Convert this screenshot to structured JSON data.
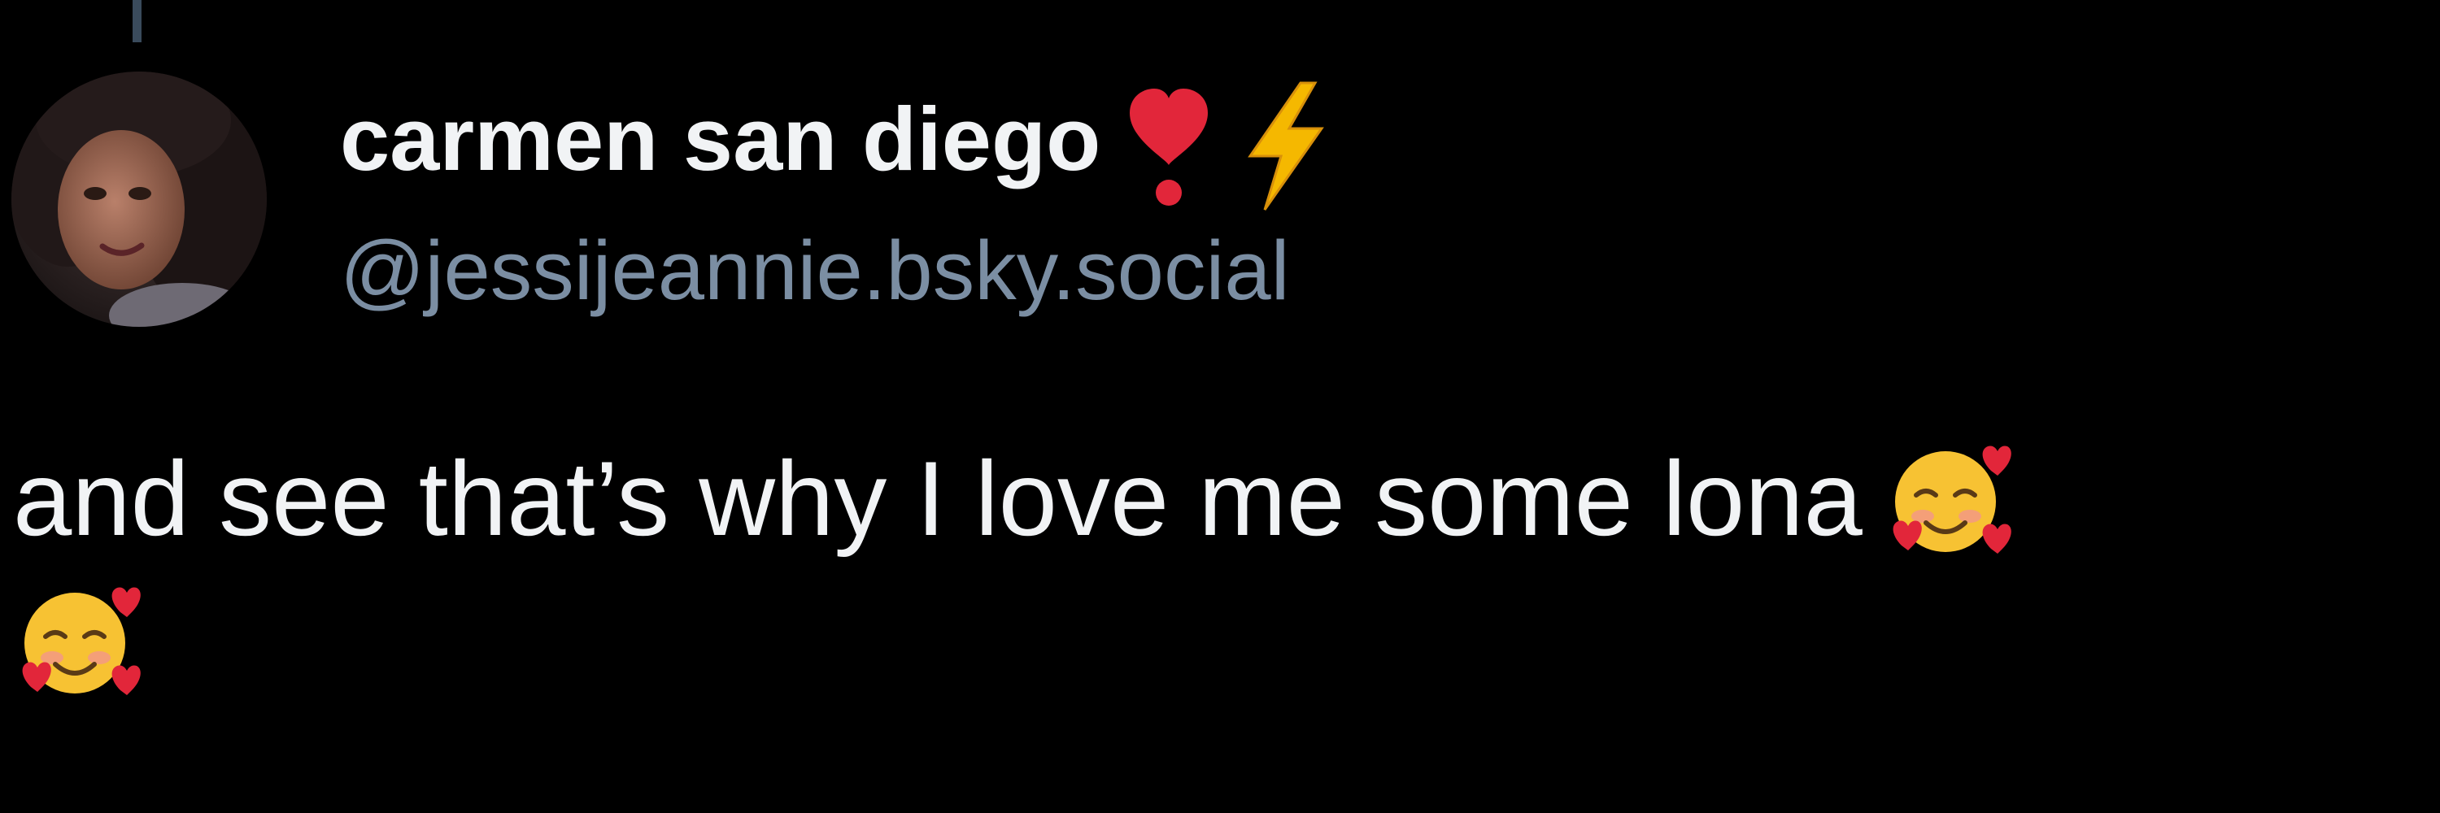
{
  "post": {
    "author": {
      "display_name": "carmen san diego",
      "handle": "@jessijeannie.bsky.social",
      "name_badges": [
        "heart-exclamation-icon",
        "lightning-icon"
      ]
    },
    "text": "and see that’s why I love me some lona",
    "trailing_emojis": [
      "smiling-face-with-hearts-icon",
      "smiling-face-with-hearts-icon"
    ]
  },
  "colors": {
    "background": "#000000",
    "primary_text": "#f1f3f5",
    "handle_text": "#7b8ea3",
    "thread_line": "#3a4b5c",
    "heart_red": "#e2263a",
    "lightning_yellow": "#f5b800",
    "emoji_face": "#f7c233"
  }
}
